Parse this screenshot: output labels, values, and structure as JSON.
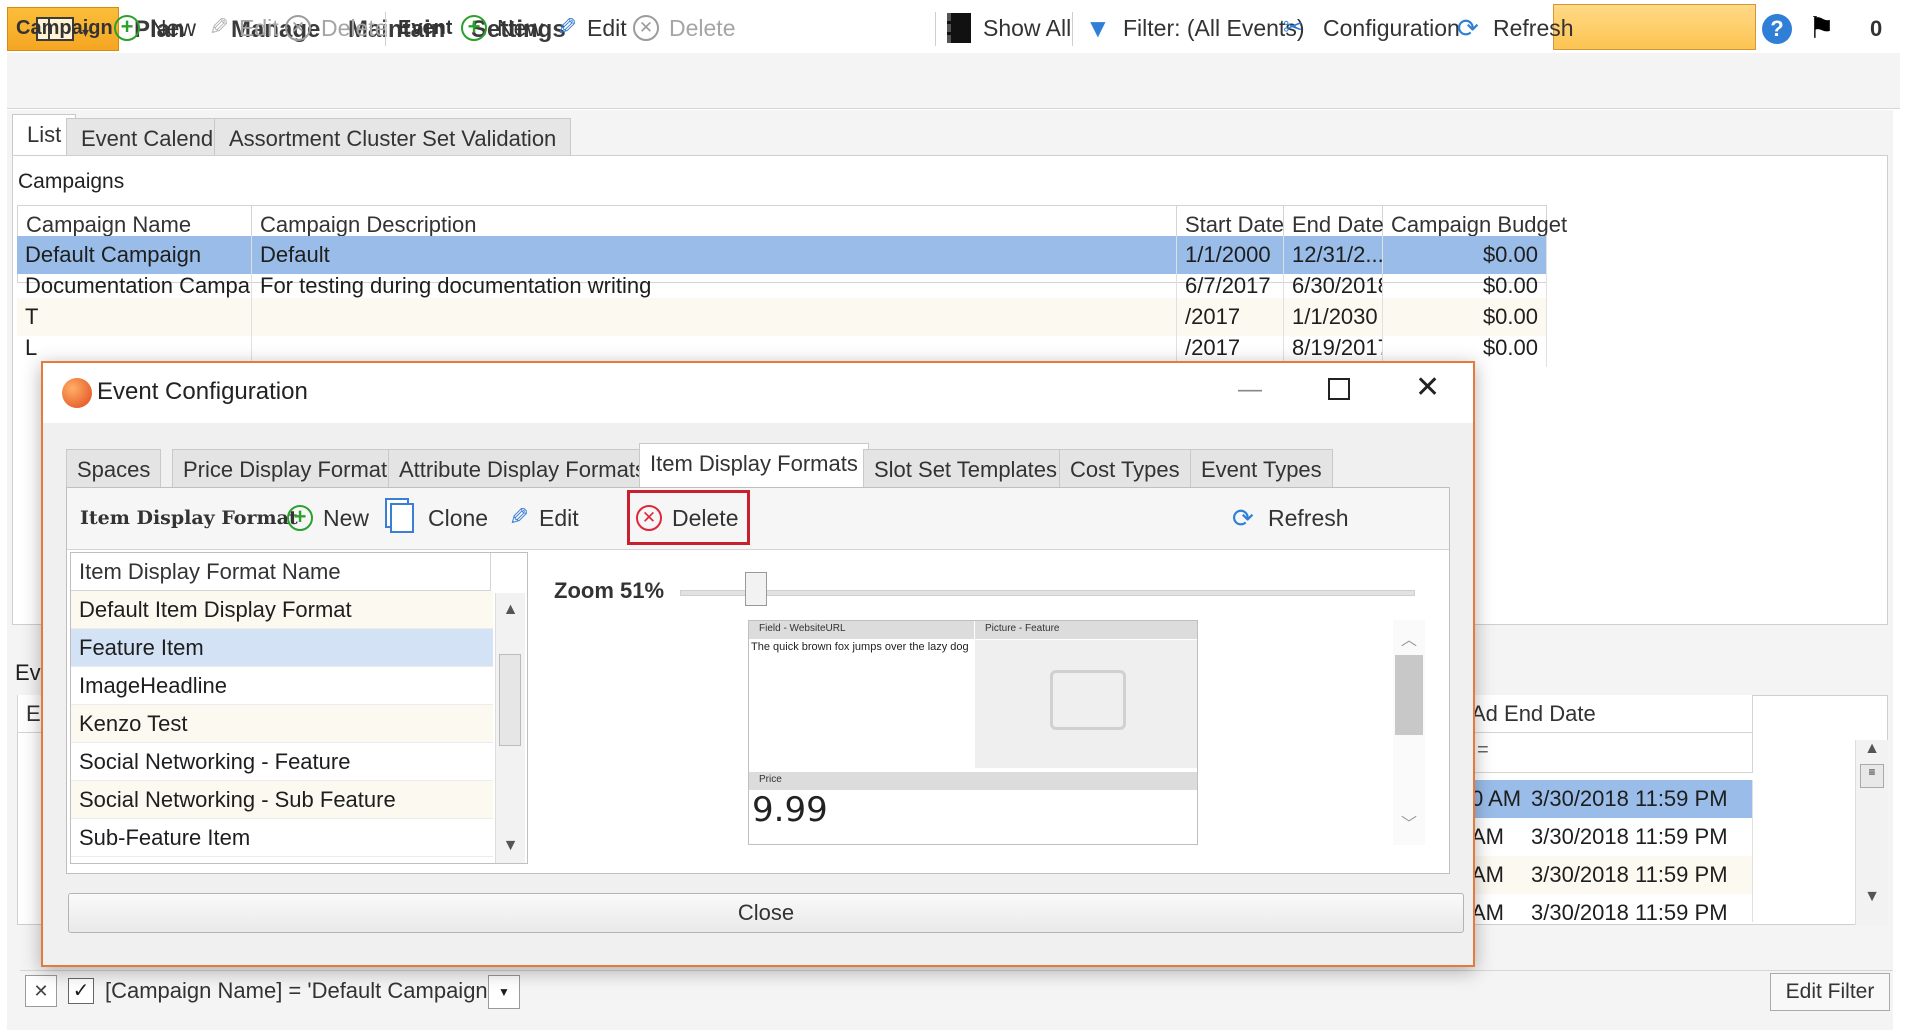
{
  "menu": {
    "items": [
      "Plan",
      "Manage",
      "Maintain",
      "Settings"
    ],
    "notification_count": "0"
  },
  "toolbar": {
    "campaign_label": "Campaign",
    "campaign_new": "New",
    "campaign_edit": "Edit",
    "campaign_delete": "Delete",
    "event_label": "Event",
    "event_new": "New",
    "event_edit": "Edit",
    "event_delete": "Delete",
    "show_all": "Show All",
    "filter": "Filter: (All Events)",
    "configuration": "Configuration",
    "refresh": "Refresh"
  },
  "tabs": [
    "List",
    "Event Calendar",
    "Assortment Cluster Set Validation"
  ],
  "campaigns": {
    "title": "Campaigns",
    "columns": [
      "Campaign Name",
      "Campaign Description",
      "Start Date",
      "End Date",
      "Campaign Budget"
    ],
    "abc_icon": "ABC",
    "rows": [
      {
        "name": "Default Campaign",
        "description": "Default",
        "start": "1/1/2000",
        "end": "12/31/2...",
        "budget": "$0.00"
      },
      {
        "name": "Documentation Campaign",
        "description": "For testing during documentation writing",
        "start": "6/7/2017",
        "end": "6/30/2018",
        "budget": "$0.00"
      },
      {
        "name": "T",
        "description": "",
        "start": "/2017",
        "end": "1/1/2030",
        "budget": "$0.00"
      },
      {
        "name": "L",
        "description": "",
        "start": "/2017",
        "end": "8/19/2017",
        "budget": "$0.00"
      }
    ]
  },
  "events": {
    "label": "Ev",
    "col_first": "E",
    "ad_end_header": "Ad End Date",
    "rows": [
      {
        "start_tail": "0 AM",
        "ad_end": "3/30/2018 11:59 PM"
      },
      {
        "start_tail": "AM",
        "ad_end": "3/30/2018 11:59 PM"
      },
      {
        "start_tail": "AM",
        "ad_end": "3/30/2018 11:59 PM"
      },
      {
        "start_tail": "AM",
        "ad_end": "3/30/2018 11:59 PM"
      }
    ]
  },
  "filter_bar": {
    "expression": "[Campaign Name] = 'Default Campaign'",
    "edit_filter": "Edit Filter"
  },
  "dialog": {
    "title": "Event Configuration",
    "tabs": [
      "Spaces",
      "Price Display Formats",
      "Attribute Display Formats",
      "Item Display Formats",
      "Slot Set Templates",
      "Cost Types",
      "Event Types"
    ],
    "toolbar": {
      "label": "Item Display Format",
      "new": "New",
      "clone": "Clone",
      "edit": "Edit",
      "delete": "Delete",
      "refresh": "Refresh"
    },
    "list_header": "Item Display Format Name",
    "list_items": [
      "Default Item Display Format",
      "Feature Item",
      "ImageHeadline",
      "Kenzo Test",
      "Social Networking - Feature",
      "Social Networking - Sub Feature",
      "Sub-Feature Item"
    ],
    "selected_item": "Feature Item",
    "zoom_label": "Zoom 51%",
    "zoom_percent": 51,
    "preview": {
      "field_header": "Field - WebsiteURL",
      "picture_header": "Picture - Feature",
      "field_text": "The quick brown fox jumps over the lazy dog",
      "price_header": "Price",
      "price_value": "9.99"
    },
    "close": "Close"
  },
  "colors": {
    "accent_orange": "#f5a623",
    "selection_blue": "#99bce8",
    "delete_highlight": "#c8202f",
    "dialog_border": "#e57b3a"
  }
}
